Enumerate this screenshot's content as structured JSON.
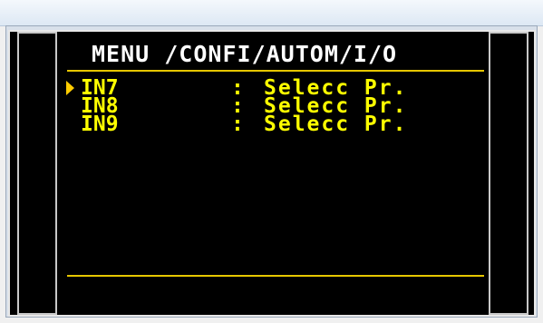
{
  "menu": {
    "title": "MENU /CONFI/AUTOM/I/O"
  },
  "rows": [
    {
      "name": "IN7",
      "separator": ":",
      "value": "Selecc Pr.",
      "selected": true
    },
    {
      "name": "IN8",
      "separator": ":",
      "value": "Selecc Pr.",
      "selected": false
    },
    {
      "name": "IN9",
      "separator": ":",
      "value": "Selecc Pr.",
      "selected": false
    }
  ],
  "colors": {
    "title": "#ffffff",
    "item_text": "#ffff00",
    "rule": "#e6c600",
    "screen_bg": "#000000"
  },
  "icons": {
    "cursor": "selection-cursor-icon"
  }
}
